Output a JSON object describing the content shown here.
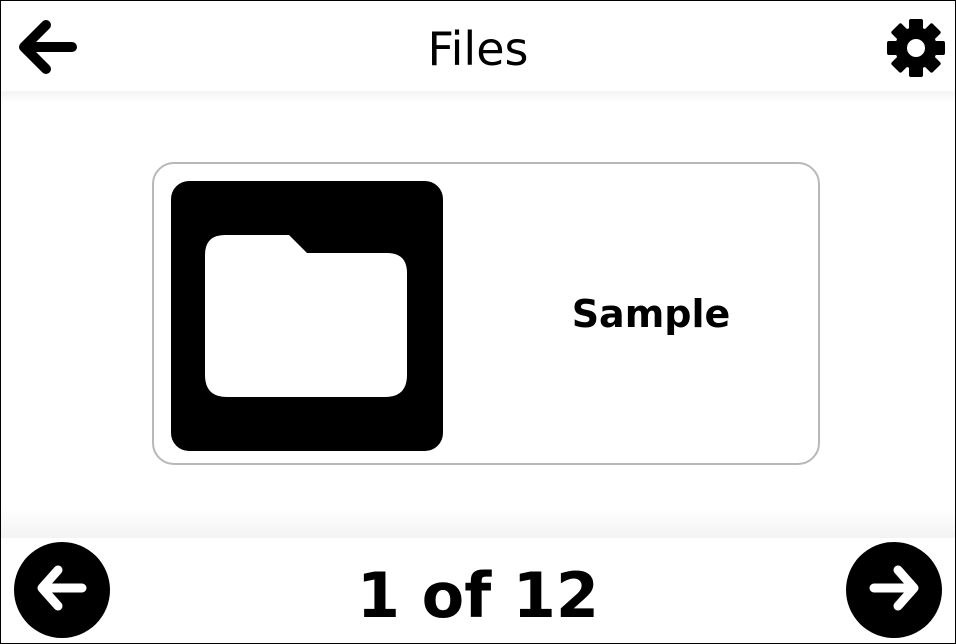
{
  "header": {
    "title": "Files",
    "back_icon": "arrow-left-icon",
    "settings_icon": "gear-icon"
  },
  "file": {
    "name": "Sample",
    "icon": "folder-icon"
  },
  "pager": {
    "current": 1,
    "total": 12,
    "label": "1 of 12",
    "prev_icon": "circle-arrow-left-icon",
    "next_icon": "circle-arrow-right-icon"
  },
  "colors": {
    "background": "#ffffff",
    "foreground": "#000000",
    "card_border": "#b8b8b8"
  }
}
